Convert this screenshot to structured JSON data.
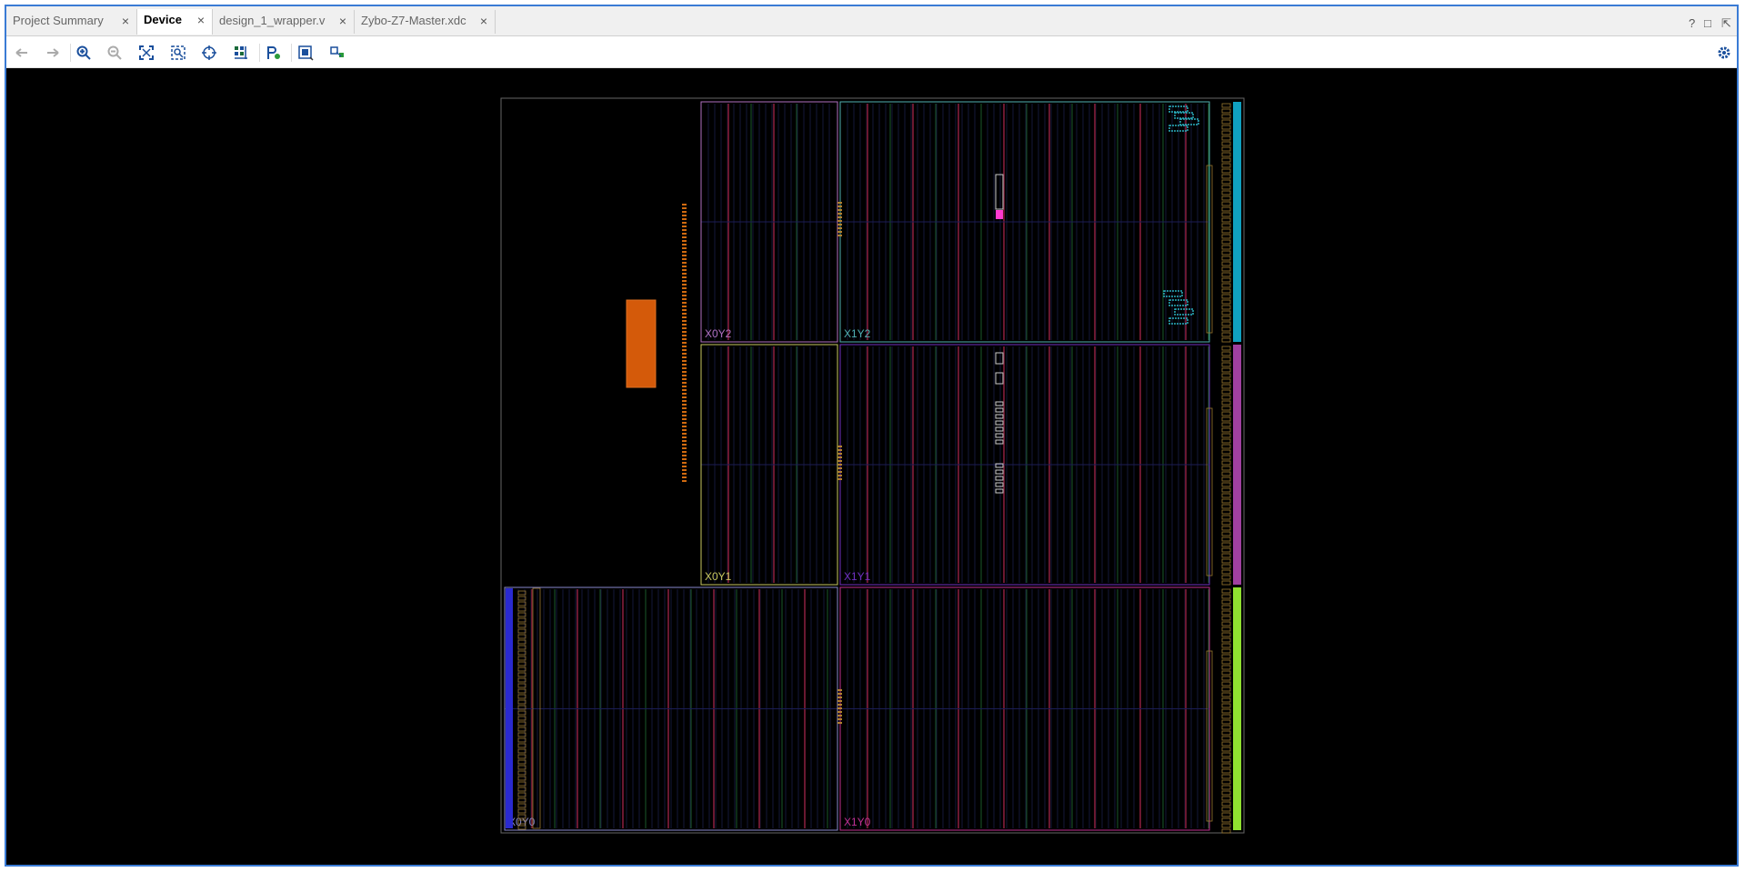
{
  "tabs": [
    {
      "label": "Project Summary",
      "active": false
    },
    {
      "label": "Device",
      "active": true
    },
    {
      "label": "design_1_wrapper.v",
      "active": false
    },
    {
      "label": "Zybo-Z7-Master.xdc",
      "active": false
    }
  ],
  "tab_close_glyph": "×",
  "window_controls": {
    "help": "?",
    "restore": "□",
    "float": "⇱"
  },
  "toolbar_icons": [
    "back-arrow-icon",
    "forward-arrow-icon",
    "zoom-in-icon",
    "zoom-out-icon",
    "zoom-fit-icon",
    "zoom-to-selection-icon",
    "autofit-selection-icon",
    "routing-resources-icon",
    "pblock-icon",
    "device-view-options-icon",
    "show-hide-icon"
  ],
  "settings_icon": "gear-icon",
  "device": {
    "clock_regions": [
      {
        "name": "X0Y2",
        "color": "#b070c0"
      },
      {
        "name": "X1Y2",
        "color": "#4fb0b0"
      },
      {
        "name": "X0Y1",
        "color": "#c8c860"
      },
      {
        "name": "X1Y1",
        "color": "#7030c0"
      },
      {
        "name": "X0Y0",
        "color": "#8888cc"
      },
      {
        "name": "X1Y0",
        "color": "#c03090"
      }
    ],
    "io_bank_colors": [
      "#10a0c0",
      "#a040a0",
      "#90e030"
    ],
    "ps_block_color": "#d45a0a"
  }
}
